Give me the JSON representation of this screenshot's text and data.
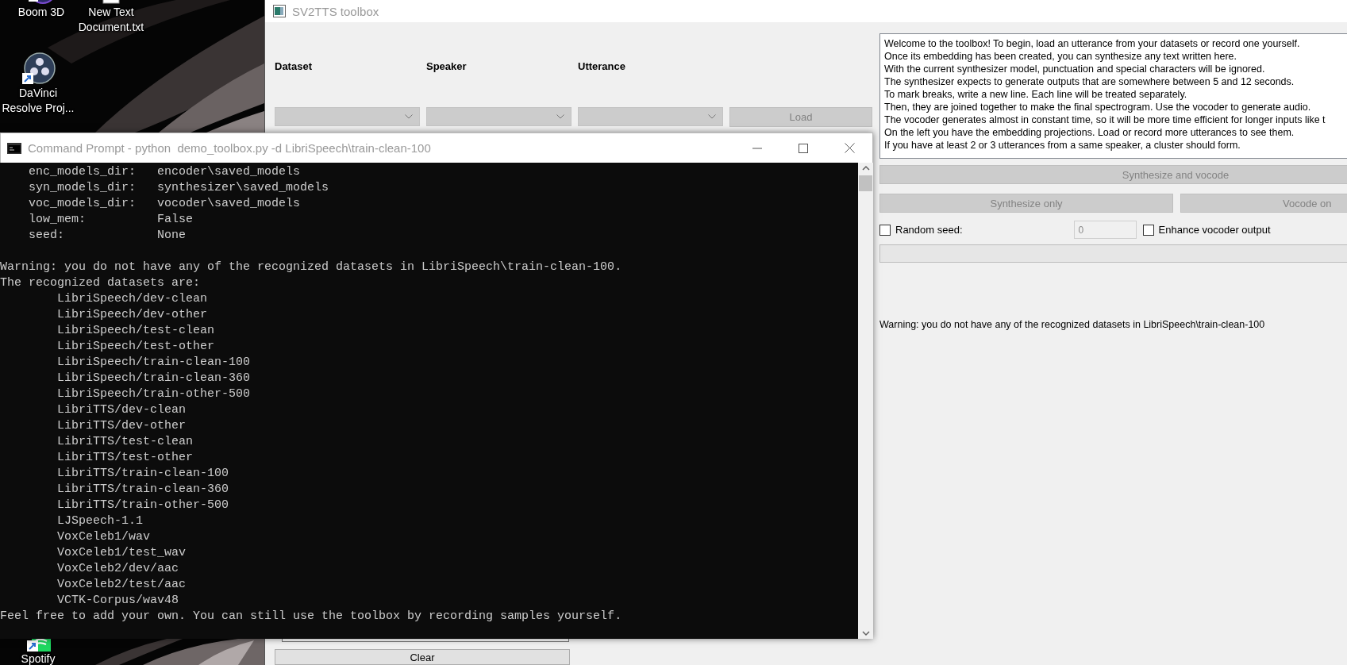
{
  "desktop": {
    "icons": [
      {
        "label": "Boom 3D",
        "kind": "boom"
      },
      {
        "label": "New Text Document.txt",
        "kind": "text-file"
      },
      {
        "label": "DaVinci Resolve Proj...",
        "kind": "davinci"
      },
      {
        "label": "Spotify",
        "kind": "spotify"
      }
    ]
  },
  "toolbox": {
    "title": "SV2TTS toolbox",
    "selectors": [
      {
        "label": "Dataset",
        "disabled": true
      },
      {
        "label": "Speaker",
        "disabled": true
      },
      {
        "label": "Utterance",
        "disabled": true
      }
    ],
    "load_button": {
      "label": "Load",
      "disabled": true
    },
    "text_area": {
      "lines": [
        "Welcome to the toolbox! To begin, load an utterance from your datasets or record one yourself.",
        "Once its embedding has been created, you can synthesize any text written here.",
        "With the current synthesizer model, punctuation and special characters will be ignored.",
        "The synthesizer expects to generate outputs that are somewhere between 5 and 12 seconds.",
        "To mark breaks, write a new line. Each line will be treated separately.",
        "Then, they are joined together to make the final spectrogram. Use the vocoder to generate audio.",
        "The vocoder generates almost in constant time, so it will be more time efficient for longer inputs like t",
        "On the left you have the embedding projections. Load or record more utterances to see them.",
        "If you have at least 2 or 3 utterances from a same speaker, a cluster should form."
      ]
    },
    "synthesize_vocode_button": {
      "label": "Synthesize and vocode",
      "disabled": true
    },
    "synthesize_only_button": {
      "label": "Synthesize only",
      "disabled": true
    },
    "vocode_only_button": {
      "label": "Vocode on",
      "disabled": true
    },
    "random_seed": {
      "label": "Random seed:",
      "checked": false
    },
    "seed_field": {
      "value": "0",
      "disabled": true
    },
    "enhance_vocoder": {
      "label": "Enhance vocoder output",
      "checked": false
    },
    "status": "Warning: you do not have any of the recognized datasets in LibriSpeech\\train-clean-100",
    "clear_button": {
      "label": "Clear",
      "disabled": false
    }
  },
  "console": {
    "title": "Command Prompt - python  demo_toolbox.py -d LibriSpeech\\train-clean-100",
    "lines": [
      {
        "kind": "param",
        "key": "enc_models_dir:",
        "value": "encoder\\saved_models"
      },
      {
        "kind": "param",
        "key": "syn_models_dir:",
        "value": "synthesizer\\saved_models"
      },
      {
        "kind": "param",
        "key": "voc_models_dir:",
        "value": "vocoder\\saved_models"
      },
      {
        "kind": "param",
        "key": "low_mem:",
        "value": "False"
      },
      {
        "kind": "param",
        "key": "seed:",
        "value": "None"
      },
      {
        "kind": "blank"
      },
      {
        "kind": "text",
        "text": "Warning: you do not have any of the recognized datasets in LibriSpeech\\train-clean-100."
      },
      {
        "kind": "text",
        "text": "The recognized datasets are:"
      },
      {
        "kind": "item",
        "text": "LibriSpeech/dev-clean"
      },
      {
        "kind": "item",
        "text": "LibriSpeech/dev-other"
      },
      {
        "kind": "item",
        "text": "LibriSpeech/test-clean"
      },
      {
        "kind": "item",
        "text": "LibriSpeech/test-other"
      },
      {
        "kind": "item",
        "text": "LibriSpeech/train-clean-100"
      },
      {
        "kind": "item",
        "text": "LibriSpeech/train-clean-360"
      },
      {
        "kind": "item",
        "text": "LibriSpeech/train-other-500"
      },
      {
        "kind": "item",
        "text": "LibriTTS/dev-clean"
      },
      {
        "kind": "item",
        "text": "LibriTTS/dev-other"
      },
      {
        "kind": "item",
        "text": "LibriTTS/test-clean"
      },
      {
        "kind": "item",
        "text": "LibriTTS/test-other"
      },
      {
        "kind": "item",
        "text": "LibriTTS/train-clean-100"
      },
      {
        "kind": "item",
        "text": "LibriTTS/train-clean-360"
      },
      {
        "kind": "item",
        "text": "LibriTTS/train-other-500"
      },
      {
        "kind": "item",
        "text": "LJSpeech-1.1"
      },
      {
        "kind": "item",
        "text": "VoxCeleb1/wav"
      },
      {
        "kind": "item",
        "text": "VoxCeleb1/test_wav"
      },
      {
        "kind": "item",
        "text": "VoxCeleb2/dev/aac"
      },
      {
        "kind": "item",
        "text": "VoxCeleb2/test/aac"
      },
      {
        "kind": "item",
        "text": "VCTK-Corpus/wav48"
      },
      {
        "kind": "text",
        "text": "Feel free to add your own. You can still use the toolbox by recording samples yourself."
      }
    ]
  }
}
